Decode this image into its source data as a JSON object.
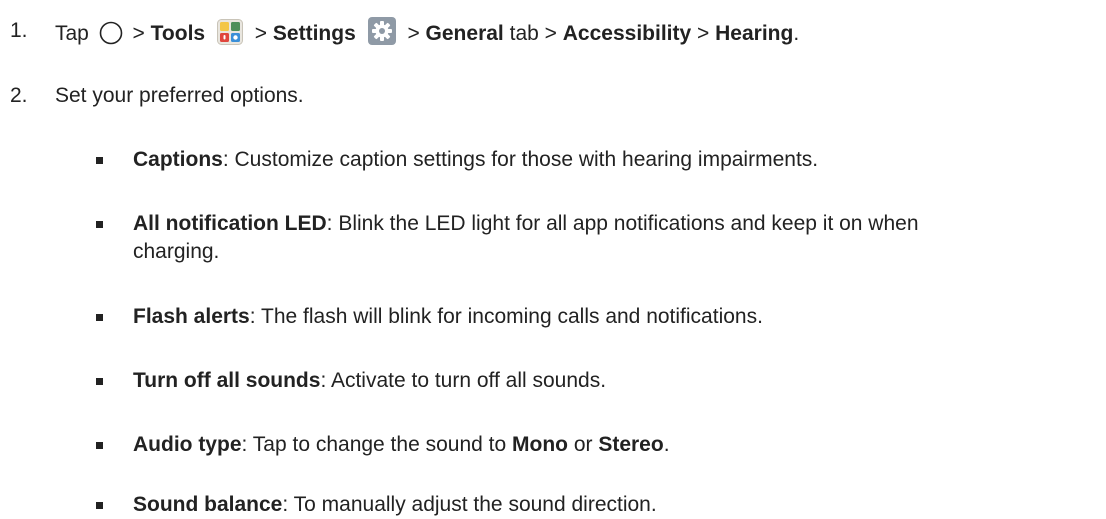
{
  "steps": [
    {
      "number": "1.",
      "tap": "Tap",
      "sep": ">",
      "tools": "Tools",
      "settings": "Settings",
      "general": "General",
      "tab": "tab",
      "accessibility": "Accessibility",
      "hearing": "Hearing",
      "end": "."
    },
    {
      "number": "2.",
      "text": "Set your preferred options."
    }
  ],
  "options": [
    {
      "term": "Captions",
      "desc": ": Customize caption settings for those with hearing impairments."
    },
    {
      "term": "All notification LED",
      "desc": ": Blink the LED light for all app notifications and keep it on when",
      "desc2": "charging."
    },
    {
      "term": "Flash alerts",
      "desc": ": The flash will blink for incoming calls and notifications."
    },
    {
      "term": "Turn off all sounds",
      "desc": ": Activate to turn off all sounds."
    },
    {
      "term": "Audio type",
      "desc": ": Tap to change the sound to ",
      "mono": "Mono",
      "or": " or ",
      "stereo": "Stereo",
      "end": "."
    },
    {
      "term": "Sound balance",
      "desc": ": To manually adjust the sound direction."
    }
  ],
  "icons": [
    "home-circle-icon",
    "tools-folder-icon",
    "settings-gear-icon"
  ],
  "colors": {
    "text": "#222222",
    "gear_bg": "#8f9aa6"
  }
}
